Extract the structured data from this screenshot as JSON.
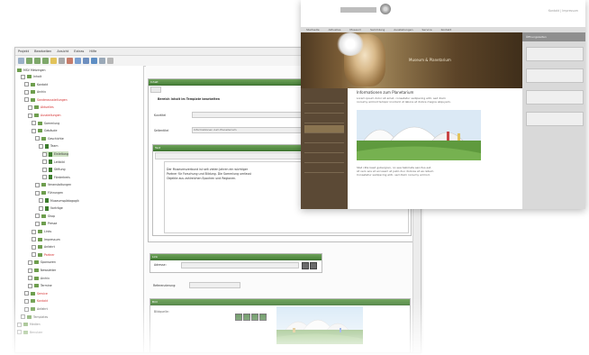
{
  "cms": {
    "menu": [
      "Projekt",
      "Bearbeiten",
      "Ansicht",
      "Extras",
      "Hilfe"
    ],
    "tree": {
      "root": "MSV Metzingen",
      "items": [
        {
          "label": "Inhalt",
          "state": "normal"
        },
        {
          "label": "Kontakt",
          "state": "normal"
        },
        {
          "label": "Archiv",
          "state": "normal"
        },
        {
          "label": "Sonderausstellungen",
          "state": "red"
        },
        {
          "label": "Aktuelles",
          "state": "red"
        },
        {
          "label": "Ausstellungen",
          "state": "red"
        },
        {
          "label": "Sammlung",
          "state": "normal"
        },
        {
          "label": "Gebäude",
          "state": "normal"
        },
        {
          "label": "Geschichte",
          "state": "normal"
        },
        {
          "label": "Team",
          "state": "normal"
        },
        {
          "label": "Einleitung",
          "state": "selected"
        },
        {
          "label": "Leitbild",
          "state": "normal"
        },
        {
          "label": "Stiftung",
          "state": "normal"
        },
        {
          "label": "Förderkreis",
          "state": "normal"
        },
        {
          "label": "Veranstaltungen",
          "state": "normal"
        },
        {
          "label": "Führungen",
          "state": "normal"
        },
        {
          "label": "Museumspädagogik",
          "state": "normal"
        },
        {
          "label": "Vorträge",
          "state": "normal"
        },
        {
          "label": "Shop",
          "state": "normal"
        },
        {
          "label": "Presse",
          "state": "normal"
        },
        {
          "label": "Links",
          "state": "normal"
        },
        {
          "label": "Impressum",
          "state": "normal"
        },
        {
          "label": "Anfahrt",
          "state": "normal"
        },
        {
          "label": "Partner",
          "state": "red"
        },
        {
          "label": "Sponsoren",
          "state": "normal"
        },
        {
          "label": "Newsletter",
          "state": "normal"
        },
        {
          "label": "Archiv",
          "state": "normal"
        },
        {
          "label": "Termine",
          "state": "normal"
        },
        {
          "label": "Service",
          "state": "red"
        },
        {
          "label": "Kontakt",
          "state": "red"
        },
        {
          "label": "Anfahrt",
          "state": "normal"
        },
        {
          "label": "Templates",
          "state": "normal"
        },
        {
          "label": "Medien",
          "state": "normal"
        },
        {
          "label": "Benutzer",
          "state": "normal"
        }
      ]
    },
    "editor": {
      "panel_title": "Inhalt",
      "section_label": "Seite",
      "form_heading": "Bereich Inhalt im Template bearbeiten",
      "fields": [
        {
          "label": "Kurztitel",
          "value": ""
        },
        {
          "label": "Seitentitel",
          "value": "Informationen zum Planetarium"
        }
      ],
      "text_panel_title": "Text",
      "text_content": [
        "Der Museumsverbund ist seit vielen Jahren ein wichtiger",
        "Partner für Forschung und Bildung. Die Sammlung umfasst",
        "Objekte aus zahlreichen Epochen und Regionen."
      ],
      "link_panel_title": "Link",
      "link_label": "Adresse:",
      "reference_label": "Referenzierung:",
      "image_panel_title": "Bild",
      "image_label": "Bildquelle:"
    }
  },
  "website": {
    "header_link": "Kontakt | Impressum",
    "nav": [
      "Startseite",
      "Aktuelles",
      "Museum",
      "Sammlung",
      "Ausstellungen",
      "Service",
      "Kontakt"
    ],
    "hero_text": "Museum & Planetarium",
    "content_title": "Informationen zum Planetarium",
    "intro": [
      "Lorem ipsum dolor sit amet, consetetur sadipscing elitr, sed diam",
      "nonumy eirmod tempor invidunt ut labore et dolore magna aliquyam."
    ],
    "body": [
      "Stet clita kasd gubergren, no sea takimata sanctus est.",
      "At vero eos et accusam et justo duo dolores et ea rebum.",
      "Consetetur sadipscing elitr, sed diam nonumy eirmod."
    ],
    "sidebar_items": 8,
    "right_title": "Öffnungszeiten"
  },
  "colors": {
    "accent_green": "#4e8a3e",
    "folder_green": "#6e9e4e",
    "hero_brown": "#7a5c36",
    "web_sidebar": "#5b4935",
    "warning_red": "#d42c2c"
  }
}
